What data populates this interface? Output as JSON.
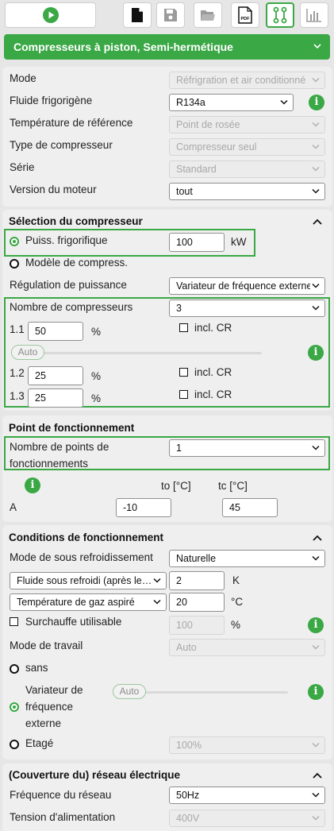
{
  "toolbar": {
    "buttons": [
      "play-icon",
      "new-file-icon",
      "save-icon",
      "open-folder-icon",
      "pdf-icon",
      "connection-icon",
      "chart-icon"
    ],
    "pdf_text": "PDF"
  },
  "banner": {
    "title": "Compresseurs à piston, Semi-hermétique"
  },
  "general": {
    "mode_label": "Mode",
    "mode_value": "Réfrigration et air conditionné",
    "fluid_label": "Fluide frigorigène",
    "fluid_value": "R134a",
    "reftemp_label": "Température de référence",
    "reftemp_value": "Point de rosée",
    "comptype_label": "Type de compresseur",
    "comptype_value": "Compresseur seul",
    "series_label": "Série",
    "series_value": "Standard",
    "motor_label": "Version du moteur",
    "motor_value": "tout"
  },
  "selection": {
    "title": "Sélection du compresseur",
    "capacity_label": "Puiss. frigorifique",
    "capacity_value": "100",
    "capacity_unit": "kW",
    "model_label": "Modèle de compress.",
    "regulation_label": "Régulation de puissance",
    "regulation_value": "Variateur de fréquence externe",
    "count_label": "Nombre de compresseurs",
    "count_value": "3",
    "comp1_label": "1.1",
    "comp1_value": "50",
    "comp1_unit": "%",
    "comp1_cr": "incl. CR",
    "auto_label": "Auto",
    "comp2_label": "1.2",
    "comp2_value": "25",
    "comp2_unit": "%",
    "comp2_cr": "incl. CR",
    "comp3_label": "1.3",
    "comp3_value": "25",
    "comp3_unit": "%",
    "comp3_cr": "incl. CR"
  },
  "operating_point": {
    "title": "Point de fonctionnement",
    "count_label_1": "Nombre de points de",
    "count_label_2": "fonctionnements",
    "count_value": "1",
    "to_header": "to [°C]",
    "tc_header": "tc [°C]",
    "row_label": "A",
    "to_value": "-10",
    "tc_value": "45"
  },
  "conditions": {
    "title": "Conditions de fonctionnement",
    "subcool_mode_label": "Mode de sous refroidissement",
    "subcool_mode_value": "Naturelle",
    "subcool_select": "Fluide sous refroidi (après le…",
    "subcool_value": "2",
    "subcool_unit": "K",
    "suction_select": "Température de gaz aspiré",
    "suction_value": "20",
    "suction_unit": "°C",
    "superheat_label": "Surchauffe utilisable",
    "superheat_value": "100",
    "superheat_unit": "%",
    "work_mode_label": "Mode de travail",
    "work_mode_value": "Auto",
    "opt_sans": "sans",
    "opt_vfd_1": "Variateur de",
    "opt_vfd_2": "fréquence",
    "opt_vfd_3": "externe",
    "auto_label": "Auto",
    "opt_stage": "Etagé",
    "stage_value": "100%"
  },
  "grid": {
    "title": "(Couverture du) réseau électrique",
    "freq_label": "Fréquence du réseau",
    "freq_value": "50Hz",
    "voltage_label": "Tension d'alimentation",
    "voltage_value": "400V"
  },
  "colors": {
    "accent": "#3aa845",
    "panel": "#efefef",
    "background": "#e6e6e6"
  }
}
